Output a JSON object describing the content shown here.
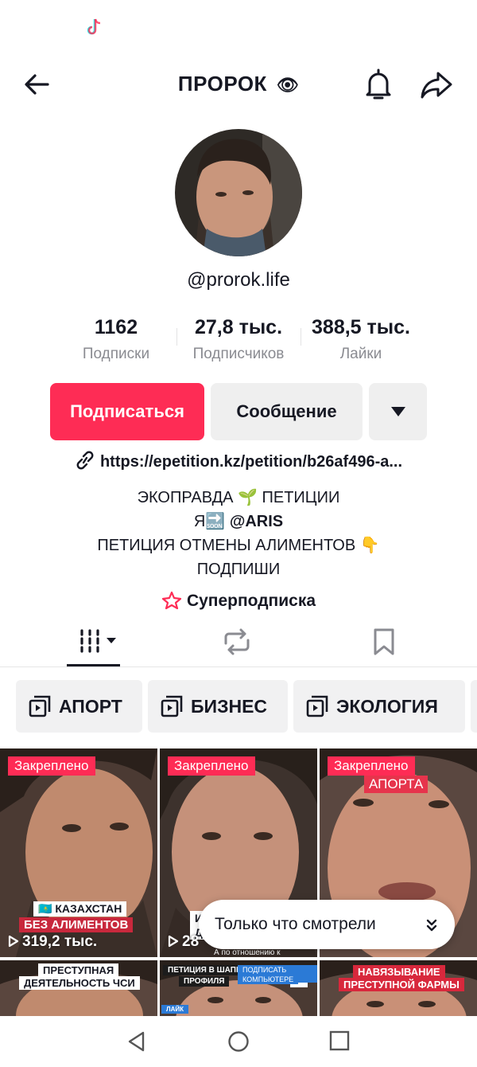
{
  "header": {
    "title": "ПРОРОК",
    "title_emoji": "👁",
    "back_icon": "arrow-left-icon",
    "bell_icon": "bell-icon",
    "share_icon": "share-arrow-icon"
  },
  "profile": {
    "username": "@prorok.life",
    "stats": [
      {
        "value": "1162",
        "label": "Подписки"
      },
      {
        "value": "27,8 тыс.",
        "label": "Подписчиков"
      },
      {
        "value": "388,5 тыс.",
        "label": "Лайки"
      }
    ],
    "follow_label": "Подписаться",
    "message_label": "Сообщение",
    "link": "https://epetition.kz/petition/b26af496-a...",
    "bio": {
      "line1": "ЭКОПРАВДА 🌱 ПЕТИЦИИ",
      "line2_prefix": "Я🔜",
      "line2_mention": "@ARIS",
      "line3": "ПЕТИЦИЯ ОТМЕНЫ АЛИМЕНТОВ 👇",
      "line4": "ПОДПИШИ"
    },
    "super_subscription": "Суперподписка"
  },
  "playlists": [
    {
      "label": "АПОРТ"
    },
    {
      "label": "БИЗНЕС"
    },
    {
      "label": "ЭКОЛОГИЯ"
    }
  ],
  "videos": [
    {
      "pinned": "Закреплено",
      "views": "319,2 тыс.",
      "tag1": "🇰🇿 КАЗАХСТАН",
      "tag2": "БЕЗ АЛИМЕНТОВ"
    },
    {
      "pinned": "Закреплено",
      "views": "28",
      "tag1": "И",
      "tag2": "Д",
      "caption": "А по отношению к"
    },
    {
      "pinned": "Закреплено",
      "tag1": "АПОРТА"
    },
    {
      "tag1": "ПРЕСТУПНАЯ",
      "tag2": "ДЕЯТЕЛЬНОСТЬ ЧСИ"
    },
    {
      "tag1": "ПЕТИЦИЯ В ШАПКЕ",
      "tag2": "ПРОФИЛЯ",
      "tag3": "ПОДПИСАТЬ МОЖНО",
      "tag4": "КОМПЬЮТЕРЕ",
      "tag5": "ЛАЙК"
    },
    {
      "tag1": "НАВЯЗЫВАНИЕ",
      "tag2": "ПРЕСТУПНОЙ ФАРМЫ"
    }
  ],
  "toast": {
    "label": "Только что смотрели"
  },
  "colors": {
    "accent": "#fe2c55",
    "text": "#161823",
    "muted": "#8a8b91",
    "button_bg": "#efefef"
  }
}
